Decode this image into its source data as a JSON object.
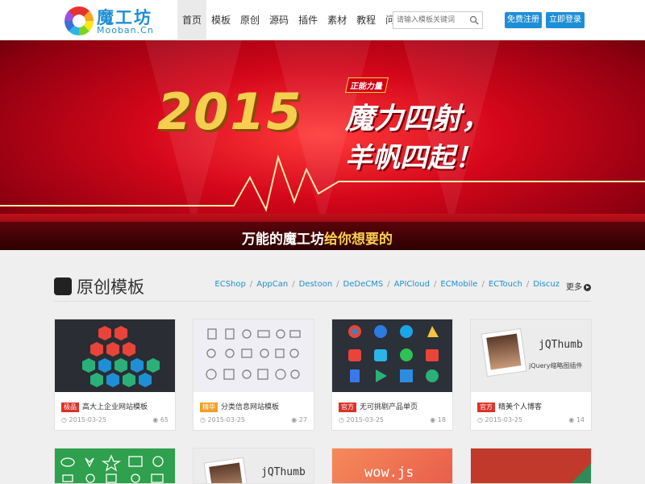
{
  "header": {
    "logo_cn": "魔工坊",
    "logo_en": "Mooban.Cn",
    "nav": [
      "首页",
      "模板",
      "原创",
      "源码",
      "插件",
      "素材",
      "教程",
      "问答"
    ],
    "search_placeholder": "请输入模板关键词",
    "register_label": "免费注册",
    "login_label": "立即登录"
  },
  "banner": {
    "year": "2015",
    "tag": "正能力量",
    "line1": "魔力四射，",
    "line2": "羊帆四起！",
    "slogan_a": "万能的魔工坊",
    "slogan_b": "给你想要的"
  },
  "section": {
    "title": "原创模板",
    "categories": [
      "ECShop",
      "AppCan",
      "Destoon",
      "DeDeCMS",
      "APICloud",
      "ECMobile",
      "ECTouch",
      "Discuz"
    ],
    "more_label": "更多"
  },
  "cards": [
    {
      "badge": "极品",
      "badge_color": "#d9332a",
      "title": "高大上企业网站模板",
      "date": "2015-03-25",
      "views": "65"
    },
    {
      "badge": "精华",
      "badge_color": "#f0a02a",
      "title": "分类信息网站模板",
      "date": "2015-03-25",
      "views": "27"
    },
    {
      "badge": "官方",
      "badge_color": "#d9332a",
      "title": "无可挑剔产品单页",
      "date": "2015-03-25",
      "views": "18"
    },
    {
      "badge": "官方",
      "badge_color": "#d9332a",
      "title": "精美个人博客",
      "date": "2015-03-25",
      "views": "14"
    }
  ],
  "thumb_text": {
    "jq_title": "jQThumb",
    "jq_sub": "jQuery缩略图插件",
    "wow": "wow.js"
  },
  "colors": {
    "brand": "#1e8fd6",
    "banner": "#d4061a",
    "gold": "#f6cf4f"
  }
}
